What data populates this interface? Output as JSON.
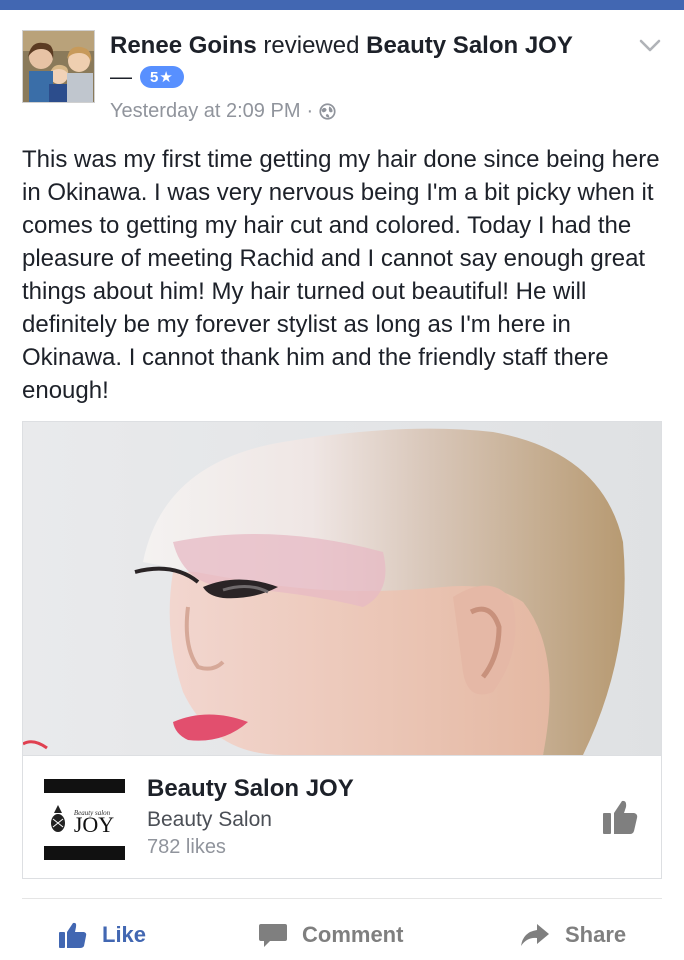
{
  "post": {
    "author": "Renee Goins",
    "action": "reviewed",
    "target": "Beauty Salon JOY",
    "dash": "—",
    "rating": "5★",
    "time": "Yesterday at 2:09 PM",
    "separator": "·",
    "privacy_icon": "globe-icon",
    "text": "This was my first time getting my hair done since being here in Okinawa. I was very nervous being I'm a bit picky when it comes to getting my hair cut and colored. Today I had the pleasure of meeting Rachid and I cannot say enough great things about him! My hair turned out beautiful! He will definitely be my forever stylist as long as I'm here in Okinawa. I cannot thank him and the friendly staff there enough!"
  },
  "page_card": {
    "name": "Beauty Salon JOY",
    "category": "Beauty Salon",
    "likes": "782 likes",
    "logo_text": "JOY",
    "logo_subtext": "Beauty salon"
  },
  "actions": {
    "like": "Like",
    "comment": "Comment",
    "share": "Share"
  },
  "colors": {
    "brand_blue": "#4267b2",
    "rating_badge": "#5890ff",
    "meta_gray": "#90949c"
  }
}
